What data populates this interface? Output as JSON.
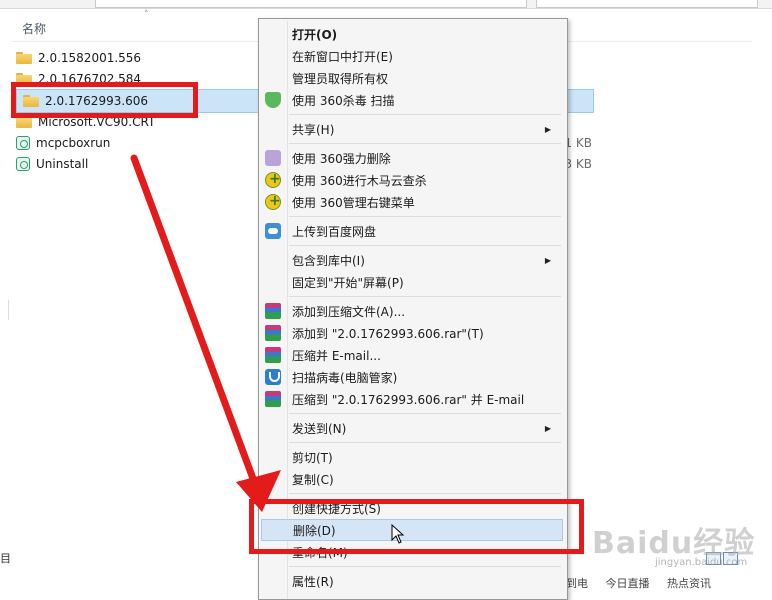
{
  "explorer": {
    "column_header": "名称",
    "files": [
      {
        "name": "2.0.1582001.556",
        "icon": "folder-icon",
        "selected": false
      },
      {
        "name": "2.0.1676702.584",
        "icon": "folder-icon",
        "selected": false
      },
      {
        "name": "2.0.1762993.606",
        "icon": "folder-icon",
        "selected": true
      },
      {
        "name": "Microsoft.VC90.CRT",
        "icon": "folder-icon",
        "selected": false
      },
      {
        "name": "mcpcboxrun",
        "icon": "app-icon",
        "size": "1 KB"
      },
      {
        "name": "Uninstall",
        "icon": "app-icon",
        "size": "3 KB"
      }
    ],
    "left_edge_char": "目",
    "status_right": [
      "装到电",
      "今日直播",
      "热点资讯"
    ]
  },
  "context_menu": {
    "items": [
      {
        "label": "打开(O)",
        "bold": true
      },
      {
        "label": "在新窗口中打开(E)"
      },
      {
        "label": "管理员取得所有权"
      },
      {
        "label": "使用 360杀毒 扫描",
        "icon": "shield-icon"
      },
      {
        "label": "共享(H)",
        "submenu": true
      },
      {
        "label": "使用 360强力删除",
        "icon": "shredder-icon"
      },
      {
        "label": "使用 360进行木马云查杀",
        "icon": "plus-icon"
      },
      {
        "label": "使用 360管理右键菜单",
        "icon": "plus-icon"
      },
      {
        "label": "上传到百度网盘",
        "icon": "cloud-icon"
      },
      {
        "label": "包含到库中(I)",
        "submenu": true
      },
      {
        "label": "固定到\"开始\"屏幕(P)"
      },
      {
        "label": "添加到压缩文件(A)...",
        "icon": "rar-icon"
      },
      {
        "label": "添加到 \"2.0.1762993.606.rar\"(T)",
        "icon": "rar-icon"
      },
      {
        "label": "压缩并 E-mail...",
        "icon": "rar-icon"
      },
      {
        "label": "扫描病毒(电脑管家)",
        "icon": "guard-icon"
      },
      {
        "label": "压缩到 \"2.0.1762993.606.rar\" 并 E-mail",
        "icon": "rar-icon"
      },
      {
        "label": "发送到(N)",
        "submenu": true
      },
      {
        "label": "剪切(T)"
      },
      {
        "label": "复制(C)"
      },
      {
        "label": "创建快捷方式(S)"
      },
      {
        "label": "删除(D)",
        "hover": true
      },
      {
        "label": "重命名(M)"
      },
      {
        "label": "属性(R)"
      }
    ]
  },
  "watermark": {
    "text": "Baidu经验",
    "sub": "jingyan.baidu.com"
  },
  "annotation_color": "#e31b1b",
  "highlight_color": "#cce4f7"
}
